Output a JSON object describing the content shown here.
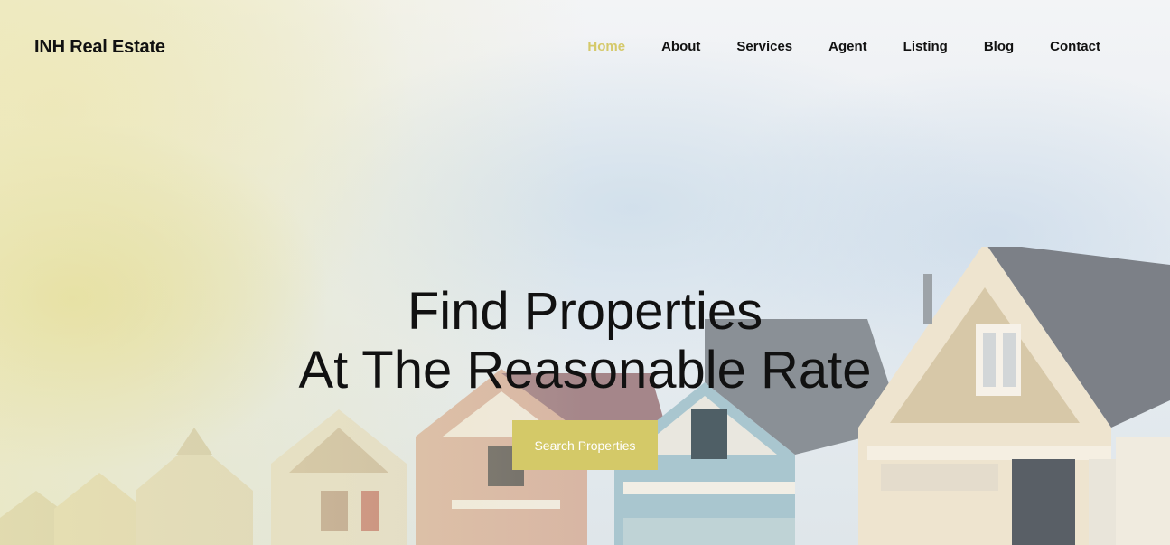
{
  "brand": {
    "name": "INH Real Estate"
  },
  "nav": {
    "items": [
      {
        "label": "Home",
        "active": true
      },
      {
        "label": "About"
      },
      {
        "label": "Services"
      },
      {
        "label": "Agent"
      },
      {
        "label": "Listing"
      },
      {
        "label": "Blog"
      },
      {
        "label": "Contact"
      }
    ]
  },
  "hero": {
    "title_line1": "Find Properties",
    "title_line2": "At The Reasonable Rate",
    "cta_label": "Search Properties",
    "image": "victorian-houses-photo"
  },
  "colors": {
    "accent": "#d4c968",
    "text": "#111111"
  }
}
